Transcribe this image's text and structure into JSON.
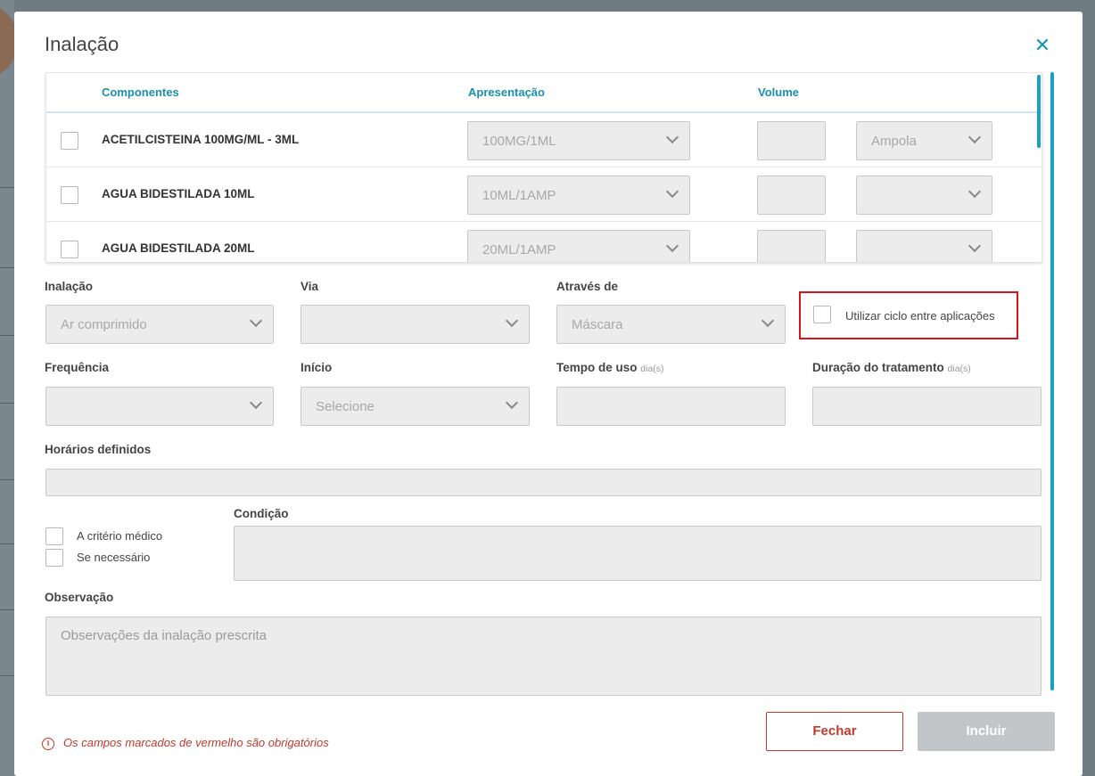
{
  "modal": {
    "title": "Inalação",
    "close_icon": "close-icon"
  },
  "table": {
    "headers": {
      "componentes": "Componentes",
      "apresentacao": "Apresentação",
      "volume": "Volume"
    },
    "rows": [
      {
        "name": "ACETILCISTEINA 100MG/ML - 3ML",
        "apresentacao": "100MG/1ML",
        "volume": "",
        "unidade": "Ampola"
      },
      {
        "name": "AGUA BIDESTILADA 10ML",
        "apresentacao": "10ML/1AMP",
        "volume": "",
        "unidade": ""
      },
      {
        "name": "AGUA BIDESTILADA 20ML",
        "apresentacao": "20ML/1AMP",
        "volume": "",
        "unidade": ""
      }
    ]
  },
  "form": {
    "inalacao": {
      "label": "Inalação",
      "value": "Ar comprimido"
    },
    "via": {
      "label": "Via",
      "value": ""
    },
    "atraves": {
      "label": "Através de",
      "value": "Máscara"
    },
    "ciclo": {
      "label": "Utilizar ciclo entre aplicações",
      "checked": false
    },
    "frequencia": {
      "label": "Frequência",
      "value": ""
    },
    "inicio": {
      "label": "Início",
      "value": "Selecione"
    },
    "tempo_uso": {
      "label": "Tempo de uso",
      "unit": "dia(s)",
      "value": ""
    },
    "duracao": {
      "label": "Duração do tratamento",
      "unit": "dia(s)",
      "value": ""
    },
    "horarios": {
      "label": "Horários definidos",
      "value": ""
    },
    "criterio_medico": {
      "label": "A critério médico",
      "checked": false
    },
    "se_necessario": {
      "label": "Se necessário",
      "checked": false
    },
    "condicao": {
      "label": "Condição",
      "value": ""
    },
    "observacao": {
      "label": "Observação",
      "placeholder": "Observações da inalação prescrita"
    }
  },
  "footer": {
    "required_note": "Os campos marcados de vermelho são obrigatórios",
    "info_icon_glyph": "i",
    "fechar_label": "Fechar",
    "incluir_label": "Incluir"
  },
  "colors": {
    "accent": "#1a93b4",
    "danger": "#c0392b",
    "disabled_bg": "#ececec"
  }
}
